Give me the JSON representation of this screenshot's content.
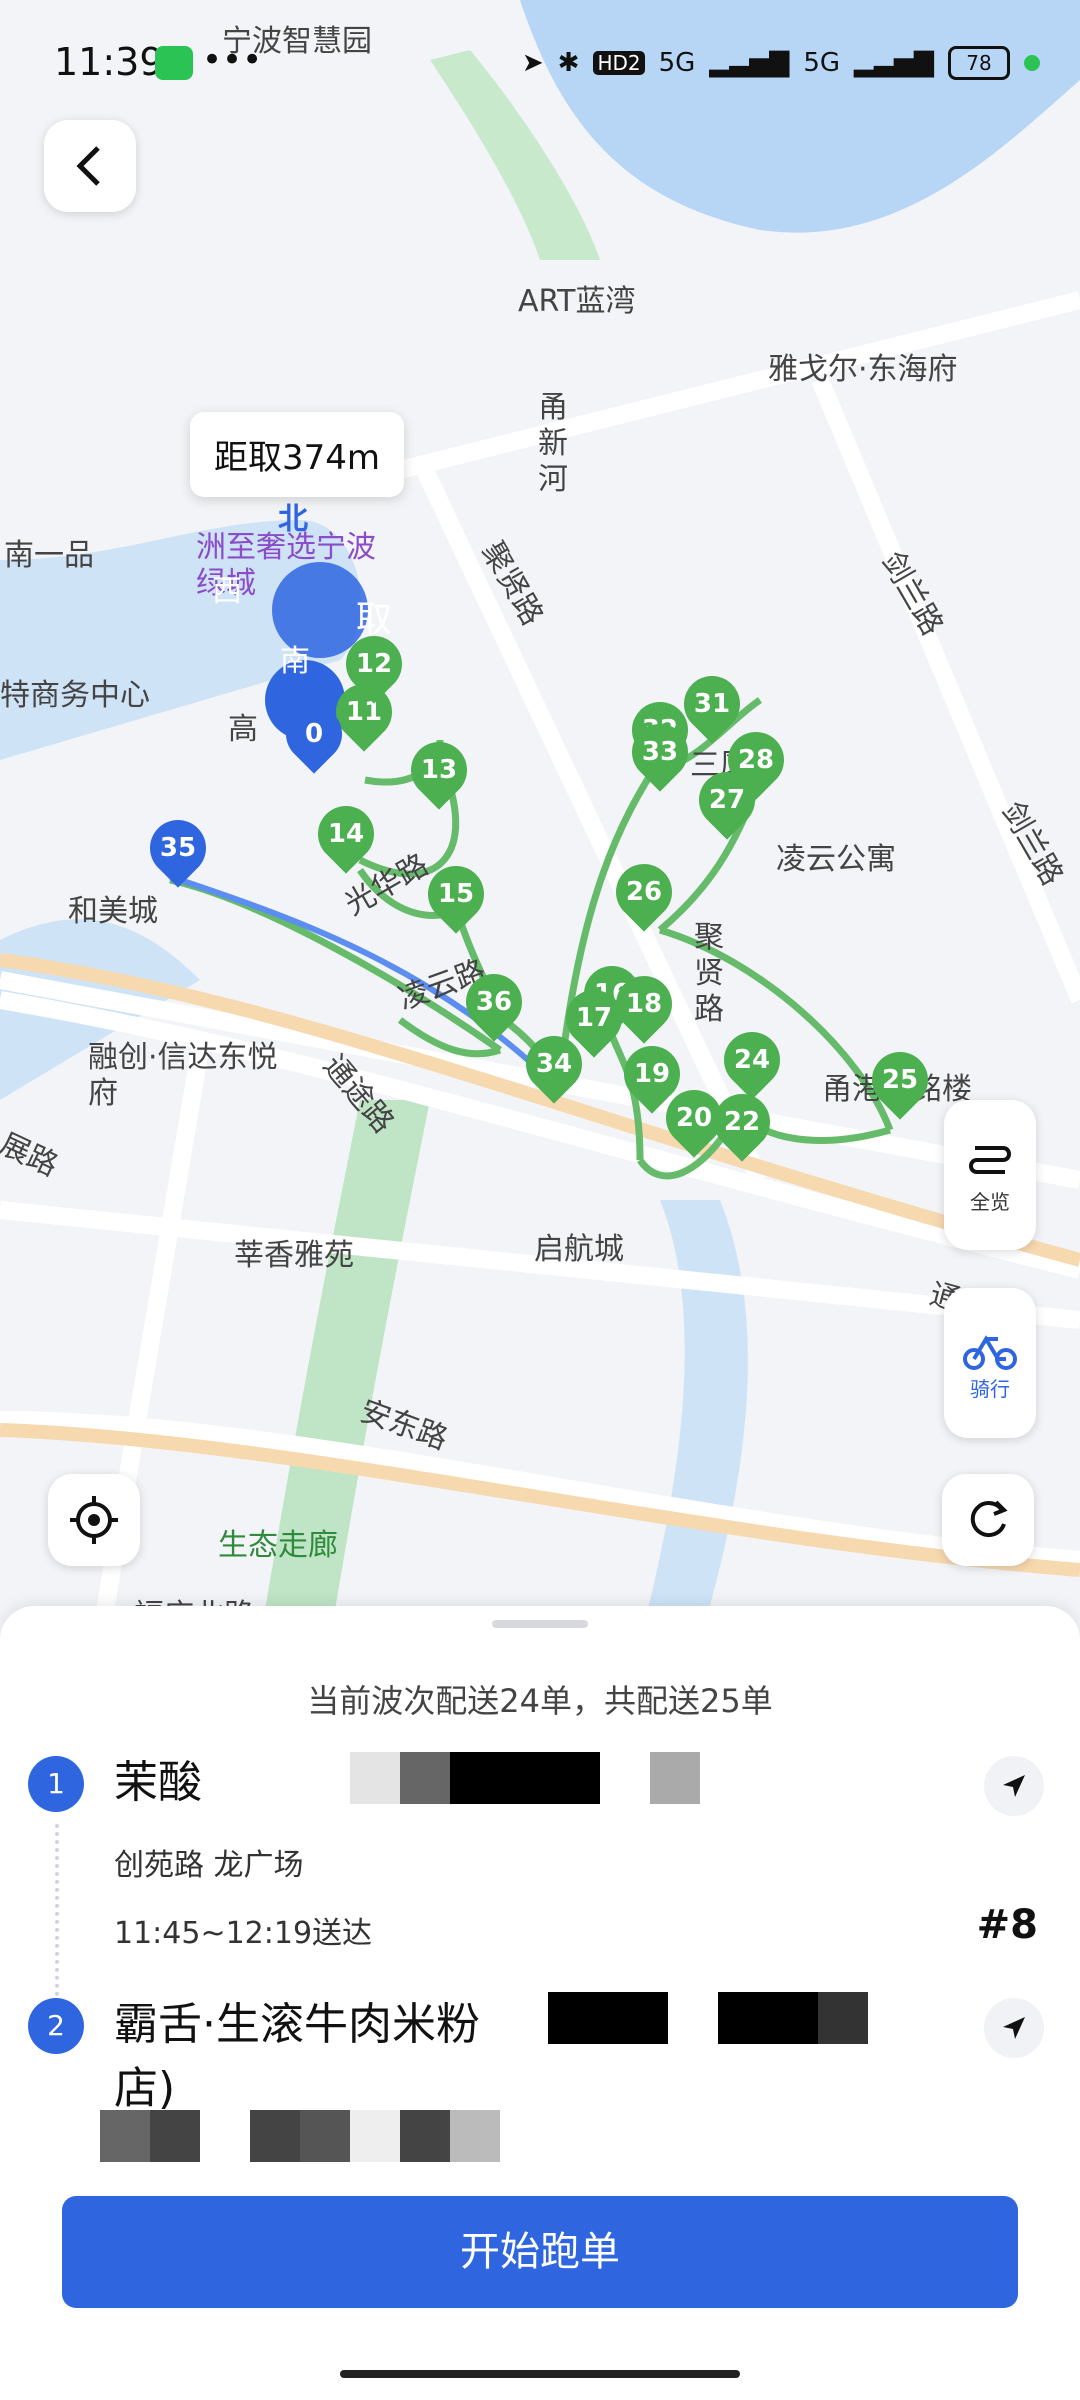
{
  "status": {
    "time": "11:39",
    "battery": "78",
    "signal_labels": [
      "HD2",
      "5G",
      "5G"
    ]
  },
  "map": {
    "distance_label": "距取374m",
    "labels": {
      "ningbo_smart_park": "宁波智慧园",
      "art_bay": "ART蓝湾",
      "yageer": "雅戈尔·东海府",
      "yongxinhe": "甬新河",
      "nanyipin": "南一品",
      "hotel": "洲至奢选宁波绿城",
      "business_center": "特商务中心",
      "juxian_rd_1": "聚贤路",
      "jianlan_rd_1": "剑兰路",
      "jianlan_rd_2": "剑兰路",
      "lingyun_apt": "凌云公寓",
      "sanjiang_bldg": "三厦",
      "heme_city": "和美城",
      "guanghua_rd": "光华路",
      "lingyun_rd": "凌云路",
      "juxian_rd_2": "聚贤路",
      "yonggang": "甬港代铭楼",
      "rongchuang": "融创·信达东悦府",
      "tongtu_rd": "通途路",
      "zhan_rd": "展路",
      "xinxiang": "莘香雅苑",
      "qihang": "启航城",
      "tongtu_rd_2": "通途路",
      "andong_rd": "安东路",
      "eco_corridor": "生态走廊",
      "fuqing_north": "福庆北路",
      "north": "北",
      "xi": "西",
      "nan": "南",
      "qu": "取",
      "gao": "高"
    },
    "buttons": {
      "overview_label": "全览",
      "ride_label": "骑行"
    },
    "markers": [
      "11",
      "12",
      "13",
      "14",
      "15",
      "16",
      "17",
      "18",
      "19",
      "20",
      "22",
      "24",
      "25",
      "26",
      "27",
      "28",
      "31",
      "32",
      "33",
      "34",
      "35",
      "36",
      "0"
    ]
  },
  "sheet": {
    "summary": "当前波次配送24单，共配送25单",
    "orders": [
      {
        "index": "1",
        "title": "茉酸",
        "address": "创苑路          龙广场",
        "time_window": "11:45~12:19送达",
        "tag": "#8"
      },
      {
        "index": "2",
        "title": "霸舌·生滚牛肉米粉",
        "title_line2": "店)",
        "address": "",
        "time_window": "",
        "tag": ""
      }
    ],
    "cta_label": "开始跑单"
  }
}
